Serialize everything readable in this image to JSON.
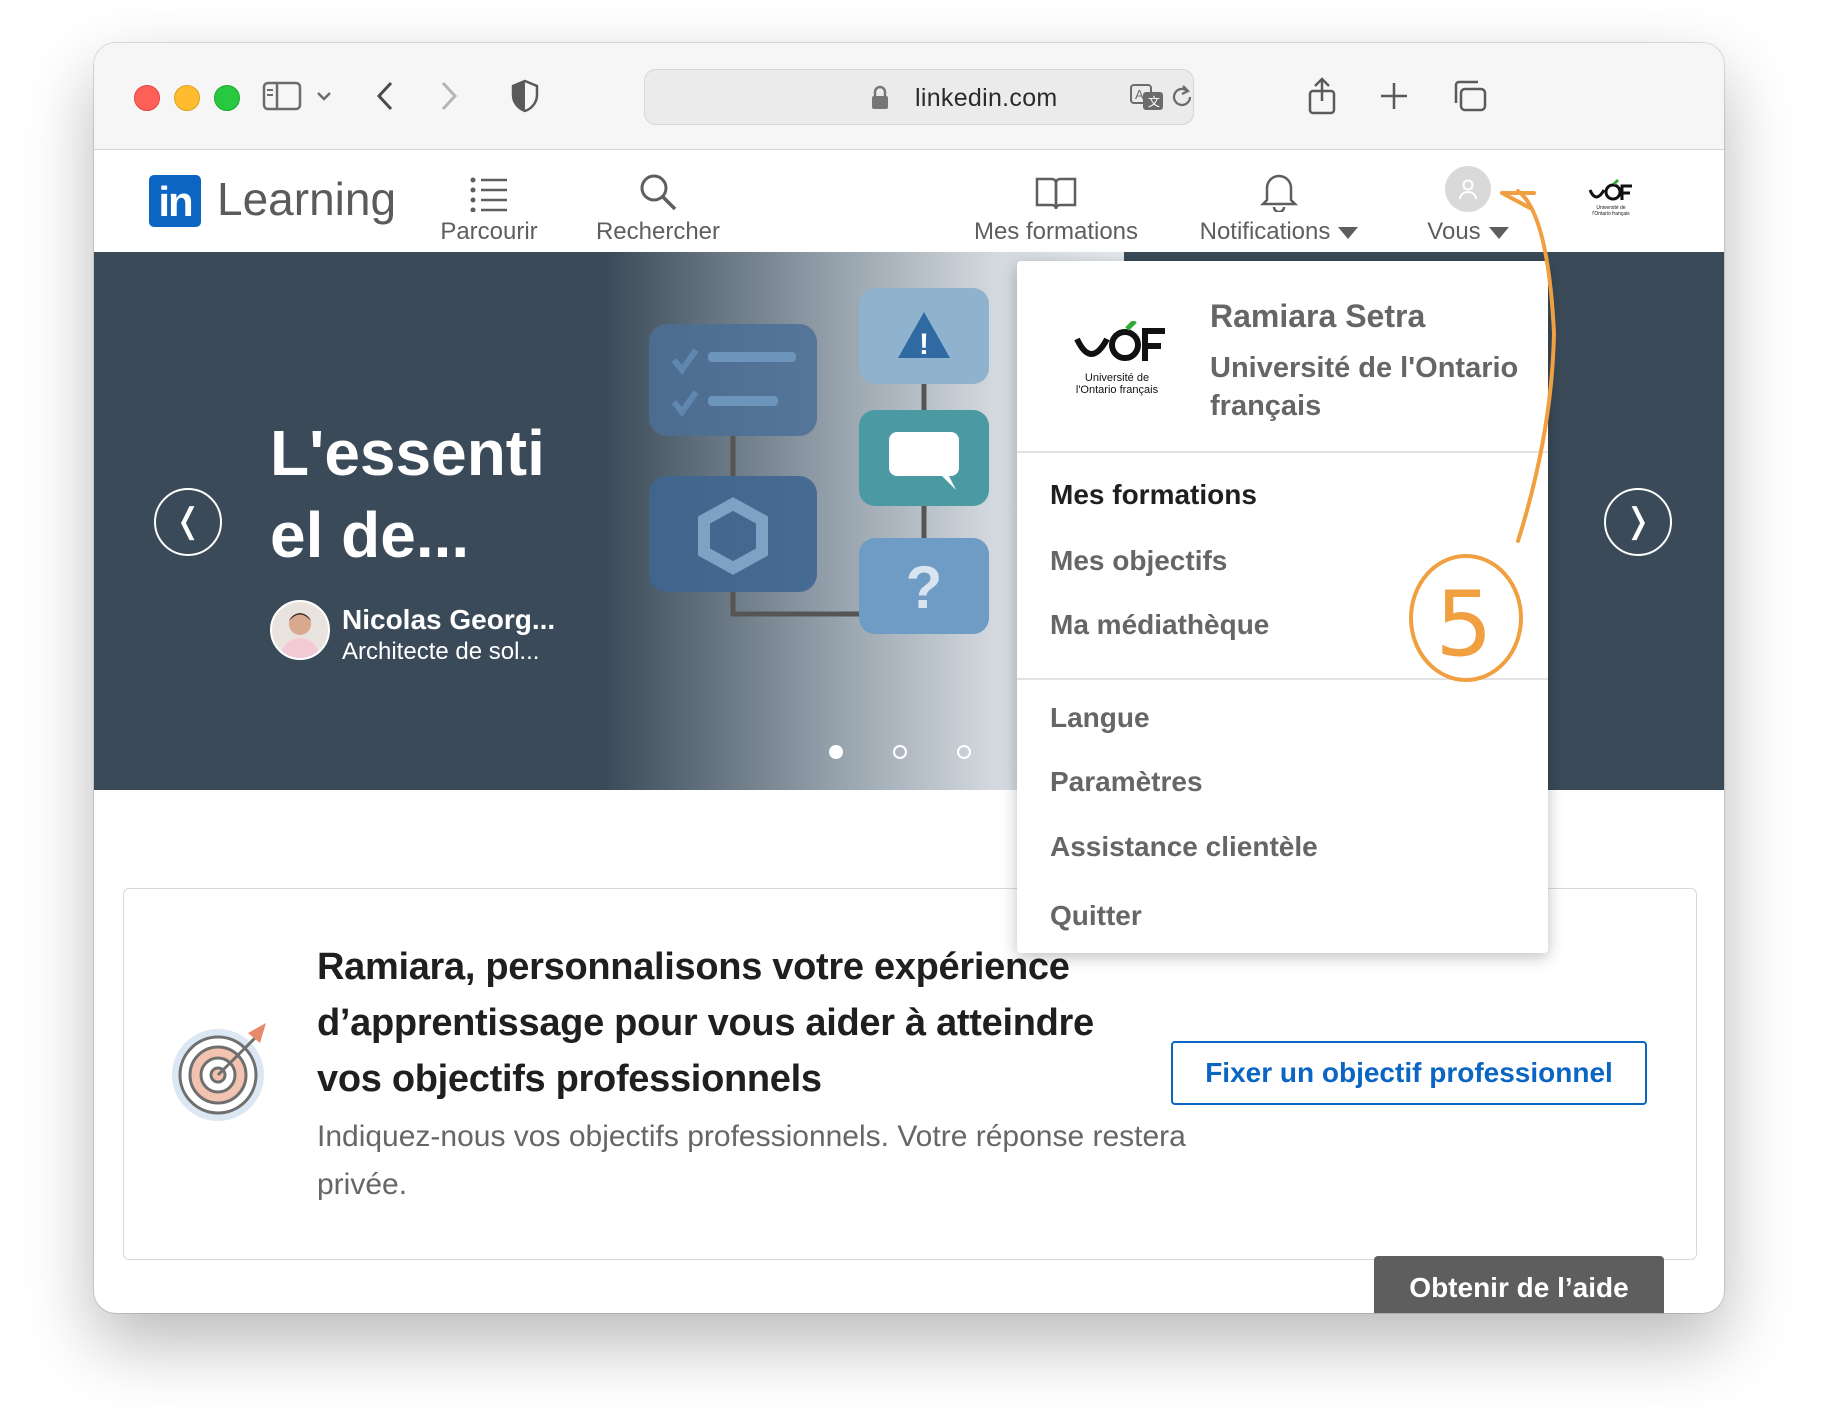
{
  "browser": {
    "url": "linkedin.com"
  },
  "nav": {
    "logo_in": "in",
    "logo_text": "Learning",
    "browse": "Parcourir",
    "search": "Rechercher",
    "my_courses": "Mes formations",
    "notifications": "Notifications",
    "me": "Vous"
  },
  "hero": {
    "title": "L'essenti el de...",
    "author_name": "Nicolas Georg...",
    "author_role": "Architecte de sol...",
    "prev": "❬",
    "next": "❭",
    "slide_count": 3,
    "active_slide": 1
  },
  "dropdown": {
    "user_name": "Ramiara Setra",
    "organization": "Université de l'Ontario français",
    "org_logo_text": "UOF",
    "org_logo_caption_1": "Université de",
    "org_logo_caption_2": "l'Ontario français",
    "items_group1": [
      "Mes formations",
      "Mes objectifs",
      "Ma médiathèque"
    ],
    "items_group2": [
      "Langue",
      "Paramètres",
      "Assistance clientèle",
      "Quitter"
    ]
  },
  "goal_card": {
    "title": "Ramiara, personnalisons votre expérience d’apprentissage pour vous aider à atteindre vos objectifs professionnels",
    "subtitle": "Indiquez-nous vos objectifs professionnels. Votre réponse restera privée.",
    "button": "Fixer un objectif professionnel"
  },
  "help_button": "Obtenir de l’aide",
  "annotation": {
    "number": "5",
    "color": "#f0a040"
  },
  "colors": {
    "brand": "#0a66c2",
    "hero_bg": "#3a4a58"
  }
}
